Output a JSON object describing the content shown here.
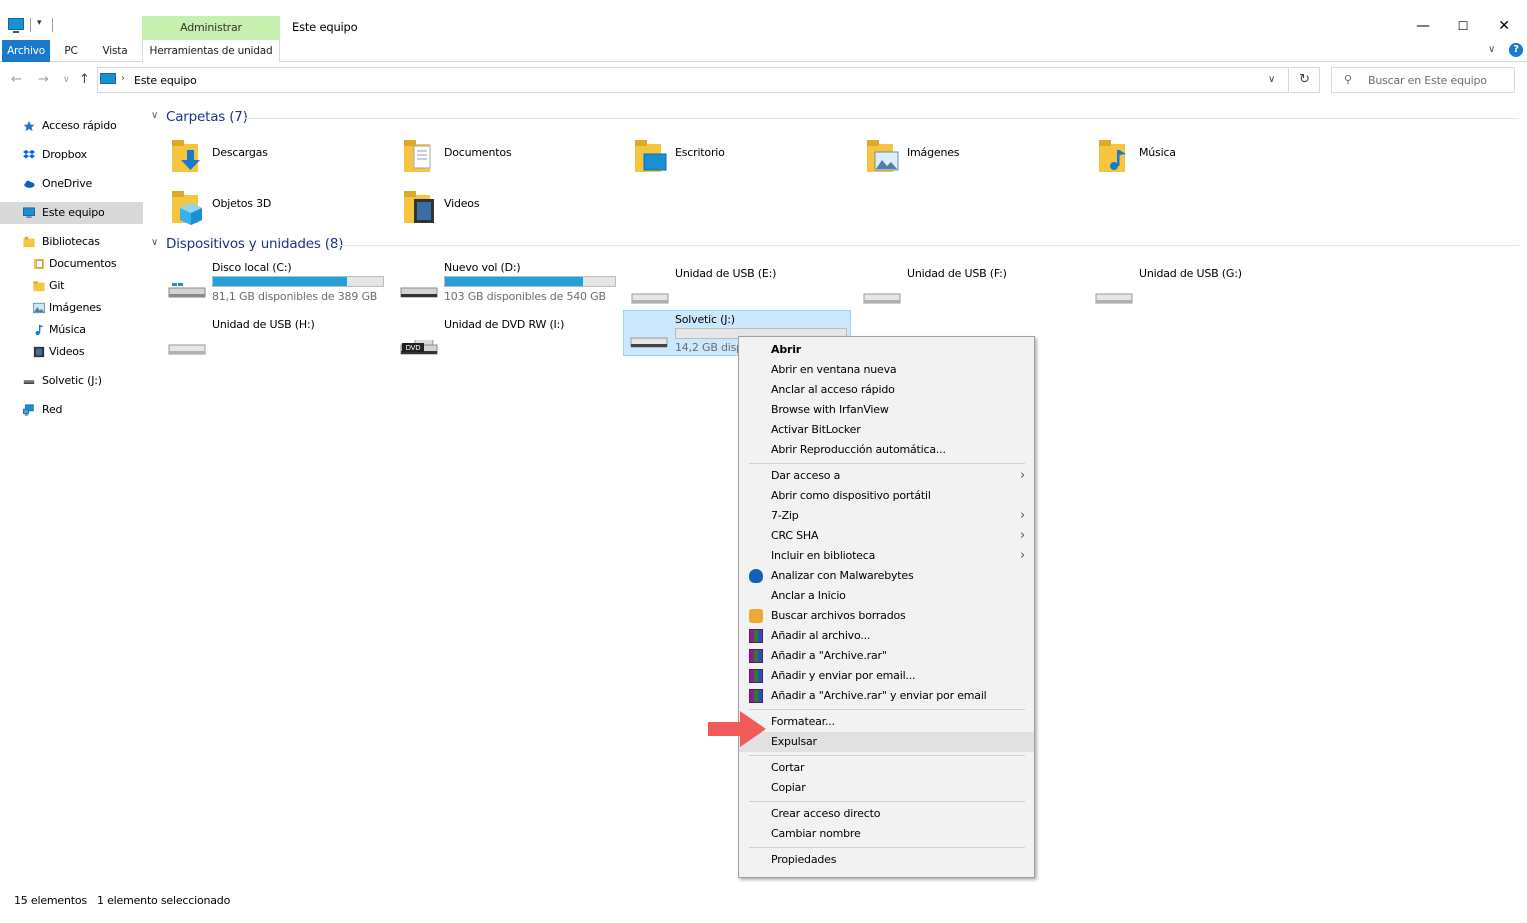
{
  "window": {
    "title": "Este equipo",
    "context_tab": "Administrar",
    "controls": {
      "minimize": "—",
      "maximize": "☐",
      "close": "✕"
    }
  },
  "ribbon": {
    "tabs": [
      "Archivo",
      "PC",
      "Vista",
      "Herramientas de unidad"
    ],
    "help": "?"
  },
  "address": {
    "path": "Este equipo",
    "search_placeholder": "Buscar en Este equipo"
  },
  "sidebar": {
    "items": [
      {
        "label": "Acceso rápido",
        "icon": "star-icon"
      },
      {
        "label": "Dropbox",
        "icon": "dropbox-icon"
      },
      {
        "label": "OneDrive",
        "icon": "cloud-icon"
      },
      {
        "label": "Este equipo",
        "icon": "computer-icon",
        "selected": true
      },
      {
        "label": "Bibliotecas",
        "icon": "library-icon"
      },
      {
        "label": "Documentos",
        "icon": "document-icon"
      },
      {
        "label": "Git",
        "icon": "folder-icon"
      },
      {
        "label": "Imágenes",
        "icon": "image-icon"
      },
      {
        "label": "Música",
        "icon": "music-icon"
      },
      {
        "label": "Videos",
        "icon": "video-icon"
      },
      {
        "label": "Solvetic (J:)",
        "icon": "usb-drive-icon"
      },
      {
        "label": "Red",
        "icon": "network-icon"
      }
    ]
  },
  "folders_section": {
    "header": "Carpetas (7)",
    "items": [
      {
        "name": "Descargas",
        "icon": "downloads-folder-icon"
      },
      {
        "name": "Documentos",
        "icon": "documents-folder-icon"
      },
      {
        "name": "Escritorio",
        "icon": "desktop-folder-icon"
      },
      {
        "name": "Imágenes",
        "icon": "pictures-folder-icon"
      },
      {
        "name": "Música",
        "icon": "music-folder-icon"
      },
      {
        "name": "Objetos 3D",
        "icon": "3d-objects-folder-icon"
      },
      {
        "name": "Videos",
        "icon": "videos-folder-icon"
      }
    ]
  },
  "drives_section": {
    "header": "Dispositivos y unidades (8)",
    "items": [
      {
        "name": "Disco local (C:)",
        "free": "81,1 GB disponibles de 389 GB",
        "used_fraction": 0.79
      },
      {
        "name": "Nuevo vol (D:)",
        "free": "103 GB disponibles de 540 GB",
        "used_fraction": 0.81
      },
      {
        "name": "Unidad de USB (E:)"
      },
      {
        "name": "Unidad de USB (F:)"
      },
      {
        "name": "Unidad de USB (G:)"
      },
      {
        "name": "Unidad de USB (H:)"
      },
      {
        "name": "Unidad de DVD RW (I:)",
        "badge": "DVD"
      },
      {
        "name": "Solvetic (J:)",
        "free": "14,2 GB dispo",
        "used_fraction": 0.0,
        "selected": true
      }
    ]
  },
  "context_menu": {
    "groups": [
      [
        "Abrir",
        "Abrir en ventana nueva",
        "Anclar al acceso rápido",
        "Browse with IrfanView",
        "Activar BitLocker",
        "Abrir Reproducción automática..."
      ],
      [
        "Dar acceso a",
        "Abrir como dispositivo portátil",
        "7-Zip",
        "CRC SHA",
        "Incluir en biblioteca",
        "Analizar con Malwarebytes",
        "Anclar a Inicio",
        "Buscar archivos borrados",
        "Añadir al archivo...",
        "Añadir a \"Archive.rar\"",
        "Añadir y enviar por email...",
        "Añadir a \"Archive.rar\" y enviar por email"
      ],
      [
        "Formatear...",
        "Expulsar"
      ],
      [
        "Cortar",
        "Copiar"
      ],
      [
        "Crear acceso directo",
        "Cambiar nombre"
      ],
      [
        "Propiedades"
      ]
    ],
    "submenu_items": [
      "Dar acceso a",
      "7-Zip",
      "CRC SHA",
      "Incluir en biblioteca"
    ],
    "hovered": "Expulsar"
  },
  "status": {
    "count": "15 elementos",
    "selection": "1 elemento seleccionado"
  },
  "colors": {
    "accent": "#1979ca",
    "context_tab": "#c6efb0",
    "selection": "#cce8ff",
    "drive_bar": "#26a0da",
    "arrow": "#f25a5a",
    "section_header": "#1e3287"
  }
}
